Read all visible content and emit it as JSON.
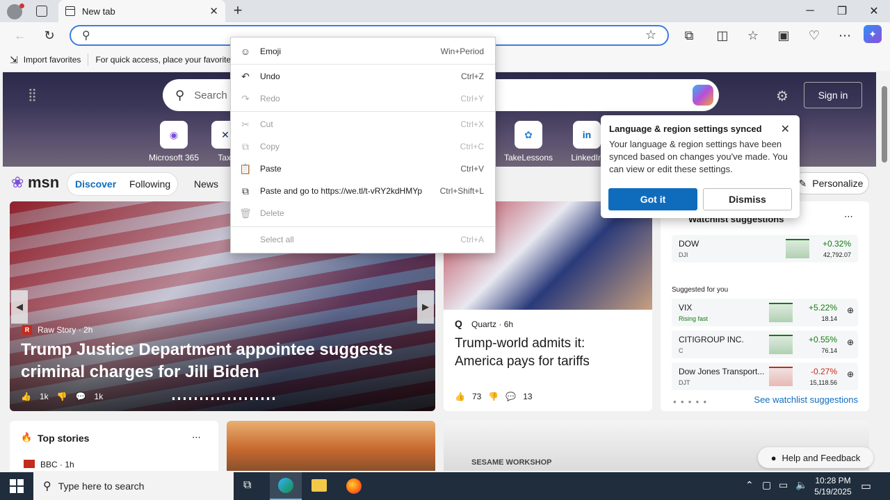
{
  "window": {
    "tab_title": "New tab",
    "close_tab": "✕",
    "new_tab": "+",
    "minimize": "─",
    "restore": "❐",
    "close": "✕"
  },
  "favorites_bar": {
    "import_label": "Import favorites",
    "hint": "For quick access, place your favorite"
  },
  "hero": {
    "search_placeholder": "Search",
    "signin": "Sign in",
    "quicklinks": [
      {
        "label": "Microsoft 365",
        "icon": "microsoft365-icon"
      },
      {
        "label": "Taxi",
        "icon": "taxi-icon"
      },
      {
        "label": "TakeLessons",
        "icon": "takelessons-icon"
      },
      {
        "label": "LinkedIn",
        "icon": "linkedin-icon"
      }
    ]
  },
  "msn": {
    "logo": "msn",
    "tabs": [
      "Discover",
      "Following",
      "News"
    ],
    "personalize": "Personalize"
  },
  "context_menu": {
    "items": [
      {
        "icon": "☺",
        "label": "Emoji",
        "shortcut": "Win+Period",
        "disabled": false
      },
      {
        "icon": "↶",
        "label": "Undo",
        "shortcut": "Ctrl+Z",
        "disabled": false
      },
      {
        "icon": "↷",
        "label": "Redo",
        "shortcut": "Ctrl+Y",
        "disabled": true
      },
      {
        "icon": "✂",
        "label": "Cut",
        "shortcut": "Ctrl+X",
        "disabled": true
      },
      {
        "icon": "⧉",
        "label": "Copy",
        "shortcut": "Ctrl+C",
        "disabled": true
      },
      {
        "icon": "📋",
        "label": "Paste",
        "shortcut": "Ctrl+V",
        "disabled": false
      },
      {
        "icon": "⧉",
        "label": "Paste and go to https://we.tl/t-vRY2kdHMYp",
        "shortcut": "Ctrl+Shift+L",
        "disabled": false
      },
      {
        "icon": "🗑",
        "label": "Delete",
        "shortcut": "",
        "disabled": true
      },
      {
        "icon": "",
        "label": "Select all",
        "shortcut": "Ctrl+A",
        "disabled": true
      }
    ]
  },
  "popup": {
    "title": "Language & region settings synced",
    "body": "Your language & region settings have been synced based on changes you've made. You can view or edit these settings.",
    "got_it": "Got it",
    "dismiss": "Dismiss"
  },
  "main_story": {
    "source": "Raw Story",
    "age": "2h",
    "headline": "Trump Justice Department appointee suggests criminal charges for Jill Biden",
    "likes": "1k",
    "comments": "1k"
  },
  "side_story": {
    "source": "Quartz",
    "age": "6h",
    "headline": "Trump-world admits it: America pays for tariffs",
    "likes": "73",
    "comments": "13"
  },
  "watchlist": {
    "title": "Watchlist suggestions",
    "suggested_label": "Suggested for you",
    "see_more": "See watchlist suggestions",
    "rows": [
      {
        "name": "DOW",
        "ticker": "DJI",
        "change": "+0.32%",
        "price": "42,792.07",
        "positive": true
      },
      {
        "name": "VIX",
        "ticker": "Rising fast",
        "change": "+5.22%",
        "price": "18.14",
        "positive": true
      },
      {
        "name": "CITIGROUP INC.",
        "ticker": "C",
        "change": "+0.55%",
        "price": "76.14",
        "positive": true
      },
      {
        "name": "Dow Jones Transport...",
        "ticker": "DJT",
        "change": "-0.27%",
        "price": "15,118.56",
        "positive": false
      }
    ]
  },
  "top_stories": {
    "title": "Top stories",
    "source": "BBC",
    "age": "1h"
  },
  "sesame_label": "SESAME WORKSHOP",
  "help": "Help and Feedback",
  "taskbar": {
    "search_placeholder": "Type here to search",
    "time": "10:28 PM",
    "date": "5/19/2025"
  },
  "colors": {
    "accent": "#0f6cbd",
    "positive": "#107c10",
    "negative": "#c42b1c"
  }
}
